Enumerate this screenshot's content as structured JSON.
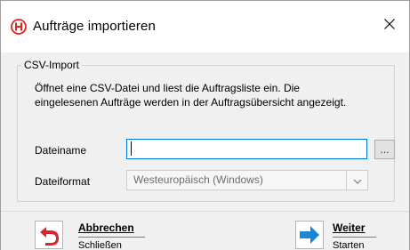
{
  "window": {
    "title": "Aufträge importieren",
    "close_glyph": "✕"
  },
  "group": {
    "legend": "CSV-Import",
    "description_line1": "Öffnet eine CSV-Datei und liest die Auftragsliste ein. Die",
    "description_line2": "eingelesenen Aufträge werden in der Auftragsübersicht angezeigt."
  },
  "form": {
    "filename_label": "Dateiname",
    "filename_value": "",
    "browse_label": "...",
    "format_label": "Dateiformat",
    "format_selected": "Westeuropäisch (Windows)"
  },
  "actions": {
    "cancel_title": "Abbrechen",
    "cancel_subtitle": "Schließen",
    "next_title": "Weiter",
    "next_subtitle": "Starten"
  },
  "colors": {
    "brand_red": "#e2231a",
    "focus_blue": "#0078d7",
    "next_arrow_blue": "#1a86d6",
    "cancel_arrow_red": "#d9252a"
  },
  "icons": {
    "app": "app-logo-icon",
    "close": "close-icon",
    "dropdown": "chevron-down-icon",
    "cancel": "undo-arrow-icon",
    "next": "arrow-right-icon"
  }
}
